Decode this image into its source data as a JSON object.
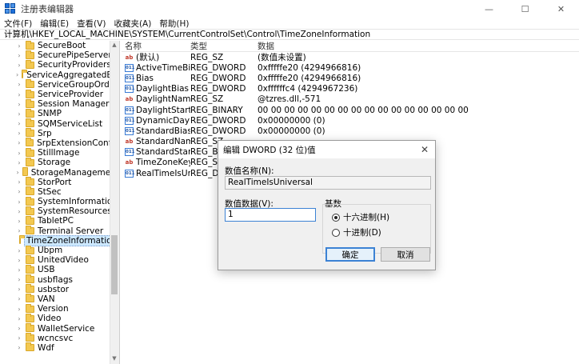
{
  "window": {
    "title": "注册表编辑器",
    "minimize_icon": "minimize-icon",
    "maximize_icon": "maximize-icon",
    "close_icon": "close-icon"
  },
  "menu": [
    "文件(F)",
    "编辑(E)",
    "查看(V)",
    "收藏夹(A)",
    "帮助(H)"
  ],
  "address": "计算机\\HKEY_LOCAL_MACHINE\\SYSTEM\\CurrentControlSet\\Control\\TimeZoneInformation",
  "tree": {
    "items": [
      {
        "label": "SecureBoot",
        "selected": false
      },
      {
        "label": "SecurePipeServers",
        "selected": false
      },
      {
        "label": "SecurityProviders",
        "selected": false
      },
      {
        "label": "ServiceAggregatedEver",
        "selected": false
      },
      {
        "label": "ServiceGroupOrder",
        "selected": false
      },
      {
        "label": "ServiceProvider",
        "selected": false
      },
      {
        "label": "Session Manager",
        "selected": false
      },
      {
        "label": "SNMP",
        "selected": false
      },
      {
        "label": "SQMServiceList",
        "selected": false
      },
      {
        "label": "Srp",
        "selected": false
      },
      {
        "label": "SrpExtensionConfig",
        "selected": false
      },
      {
        "label": "StillImage",
        "selected": false
      },
      {
        "label": "Storage",
        "selected": false
      },
      {
        "label": "StorageManagement",
        "selected": false
      },
      {
        "label": "StorPort",
        "selected": false
      },
      {
        "label": "StSec",
        "selected": false
      },
      {
        "label": "SystemInformation",
        "selected": false
      },
      {
        "label": "SystemResources",
        "selected": false
      },
      {
        "label": "TabletPC",
        "selected": false
      },
      {
        "label": "Terminal Server",
        "selected": false
      },
      {
        "label": "TimeZoneInformation",
        "selected": true
      },
      {
        "label": "Ubpm",
        "selected": false
      },
      {
        "label": "UnitedVideo",
        "selected": false
      },
      {
        "label": "USB",
        "selected": false
      },
      {
        "label": "usbflags",
        "selected": false
      },
      {
        "label": "usbstor",
        "selected": false
      },
      {
        "label": "VAN",
        "selected": false
      },
      {
        "label": "Version",
        "selected": false
      },
      {
        "label": "Video",
        "selected": false
      },
      {
        "label": "WalletService",
        "selected": false
      },
      {
        "label": "wcncsvc",
        "selected": false
      },
      {
        "label": "Wdf",
        "selected": false
      }
    ]
  },
  "values": {
    "headers": {
      "name": "名称",
      "type": "类型",
      "data": "数据"
    },
    "rows": [
      {
        "name": "(默认)",
        "type": "REG_SZ",
        "data": "(数值未设置)",
        "icon": "sz"
      },
      {
        "name": "ActiveTimeBias",
        "type": "REG_DWORD",
        "data": "0xfffffe20 (4294966816)",
        "icon": "bin"
      },
      {
        "name": "Bias",
        "type": "REG_DWORD",
        "data": "0xfffffe20 (4294966816)",
        "icon": "bin"
      },
      {
        "name": "DaylightBias",
        "type": "REG_DWORD",
        "data": "0xffffffc4 (4294967236)",
        "icon": "bin"
      },
      {
        "name": "DaylightName",
        "type": "REG_SZ",
        "data": "@tzres.dll,-571",
        "icon": "sz"
      },
      {
        "name": "DaylightStart",
        "type": "REG_BINARY",
        "data": "00 00 00 00 00 00 00 00 00 00 00 00 00 00 00 00",
        "icon": "bin"
      },
      {
        "name": "DynamicDaylig...",
        "type": "REG_DWORD",
        "data": "0x00000000 (0)",
        "icon": "bin"
      },
      {
        "name": "StandardBias",
        "type": "REG_DWORD",
        "data": "0x00000000 (0)",
        "icon": "bin"
      },
      {
        "name": "StandardName",
        "type": "REG_SZ",
        "data": "",
        "icon": "sz"
      },
      {
        "name": "StandardStart",
        "type": "REG_BIN",
        "data": "",
        "icon": "bin"
      },
      {
        "name": "TimeZoneKey...",
        "type": "REG_SZ",
        "data": "",
        "icon": "sz"
      },
      {
        "name": "RealTimeIsUniv...",
        "type": "REG_DW",
        "data": "",
        "icon": "bin"
      }
    ]
  },
  "dialog": {
    "title": "编辑 DWORD (32 位)值",
    "name_label": "数值名称(N):",
    "name_value": "RealTimeIsUniversal",
    "data_label": "数值数据(V):",
    "data_value": "1",
    "base_label": "基数",
    "radio_hex": "十六进制(H)",
    "radio_dec": "十进制(D)",
    "hex_checked": true,
    "ok_label": "确定",
    "cancel_label": "取消",
    "close_glyph": "✕"
  }
}
